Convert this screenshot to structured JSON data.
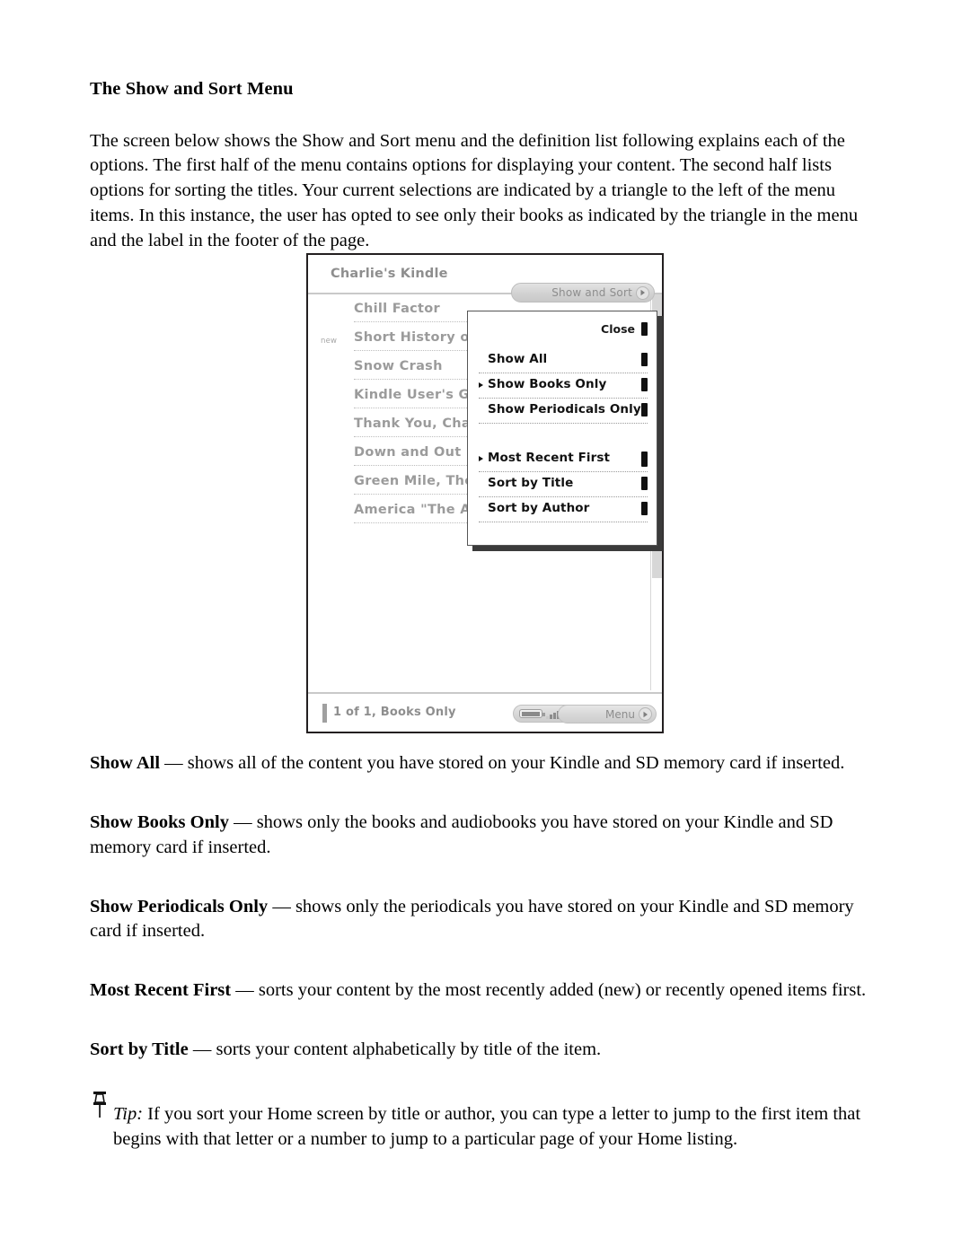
{
  "document": {
    "heading": "The Show and Sort Menu",
    "intro": "The screen below shows the Show and Sort menu and the definition list following explains each of the options. The first half of the menu contains options for displaying your content. The second half lists options for sorting the titles. Your current selections are indicated by a triangle to the left of the menu items. In this instance, the user has opted to see only their books as indicated by the triangle in the menu and the label in the footer of the page.",
    "definitions": [
      {
        "term": "Show All",
        "dash": " — ",
        "description": "shows all of the content you have stored on your Kindle and SD memory card if inserted."
      },
      {
        "term": "Show Books Only",
        "dash": " — ",
        "description": "shows only the books and audiobooks you have stored on your Kindle and SD memory card if inserted."
      },
      {
        "term": "Show Periodicals Only",
        "dash": " — ",
        "description": "shows only the periodicals you have stored on your Kindle and SD memory card if inserted."
      },
      {
        "term": "Most Recent First",
        "dash": " — ",
        "description": "sorts your content by the most recently added (new) or recently opened items first."
      },
      {
        "term": "Sort by Title",
        "dash": " — ",
        "description": "sorts your content alphabetically by title of the item."
      }
    ],
    "tip": {
      "icon": "pushpin-icon",
      "label": "Tip:",
      "text": " If you sort your Home screen by title or author, you can type a letter to jump to the first item that begins with that letter or a number to jump to a particular page of your Home listing."
    }
  },
  "kindle": {
    "device_name": "Charlie's Kindle",
    "sort_button_label": "Show and Sort",
    "library": [
      {
        "new": "",
        "title": "Chill Factor"
      },
      {
        "new": "new",
        "title": "Short History of"
      },
      {
        "new": "",
        "title": "Snow Crash"
      },
      {
        "new": "",
        "title": "Kindle User's G"
      },
      {
        "new": "",
        "title": "Thank You, Cha"
      },
      {
        "new": "",
        "title": "Down and Out i"
      },
      {
        "new": "",
        "title": "Green Mile, The"
      },
      {
        "new": "",
        "title": "America \"The A"
      }
    ],
    "menu": {
      "close_label": "Close",
      "groups": [
        {
          "items": [
            {
              "label": "Show All",
              "selected": false
            },
            {
              "label": "Show Books Only",
              "selected": true
            },
            {
              "label": "Show Periodicals Only",
              "selected": false
            }
          ]
        },
        {
          "items": [
            {
              "label": "Most Recent First",
              "selected": true
            },
            {
              "label": "Sort by Title",
              "selected": false
            },
            {
              "label": "Sort by Author",
              "selected": false
            }
          ]
        }
      ]
    },
    "footer": {
      "status": "1 of 1,  Books Only",
      "battery_icon": "battery-icon",
      "signal_icon": "signal-strength-icon",
      "menu_button_label": "Menu"
    }
  },
  "colors": {
    "page_bg": "#ffffff",
    "text": "#000000",
    "kindle_gray_text": "#9b9b9b",
    "kindle_frame": "#231f20",
    "menu_shadow": "#3b3b3b"
  }
}
